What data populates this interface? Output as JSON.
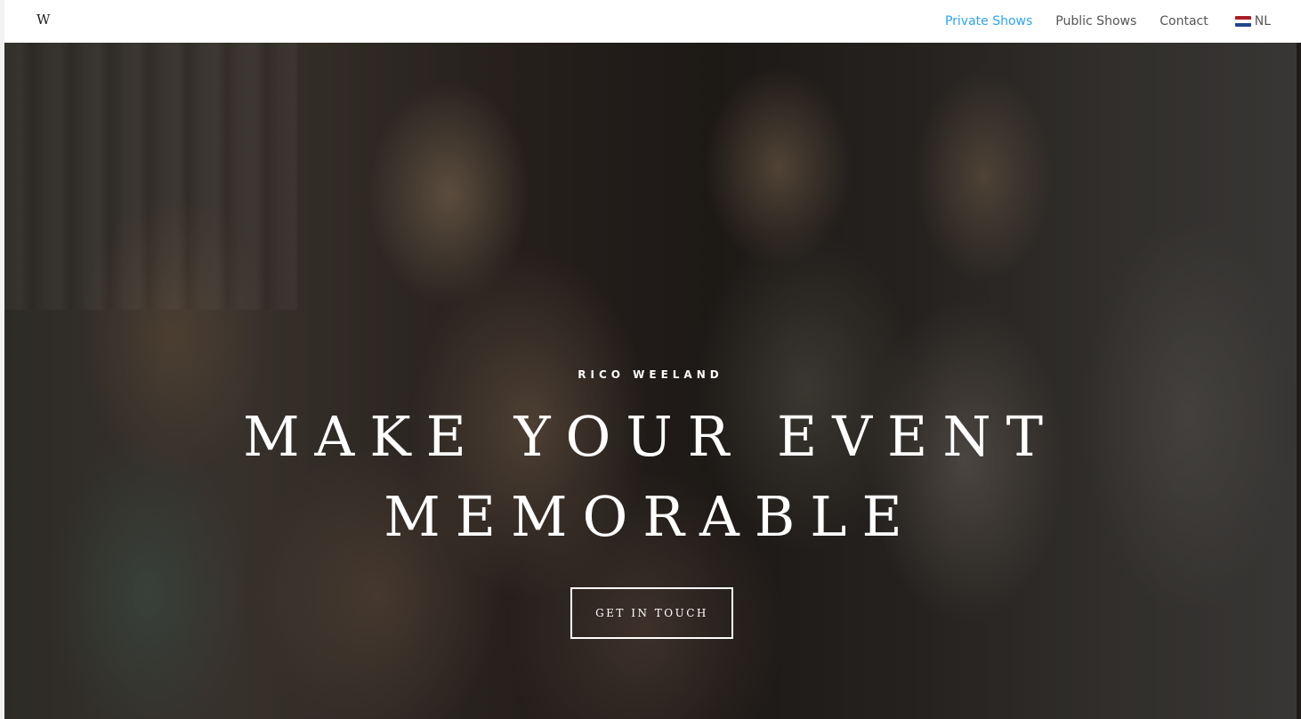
{
  "header": {
    "logo": "W",
    "nav": [
      {
        "label": "Private Shows",
        "active": true
      },
      {
        "label": "Public Shows",
        "active": false
      },
      {
        "label": "Contact",
        "active": false
      }
    ],
    "language": {
      "label": "NL",
      "flag_colors": [
        "#ae1c28",
        "#ffffff",
        "#21468b"
      ]
    }
  },
  "hero": {
    "eyebrow": "RICO WEELAND",
    "headline_line1": "MAKE YOUR EVENT",
    "headline_line2": "MEMORABLE",
    "cta_label": "GET IN TOUCH"
  },
  "colors": {
    "accent": "#2ea3f2",
    "nav_text": "#555555"
  }
}
